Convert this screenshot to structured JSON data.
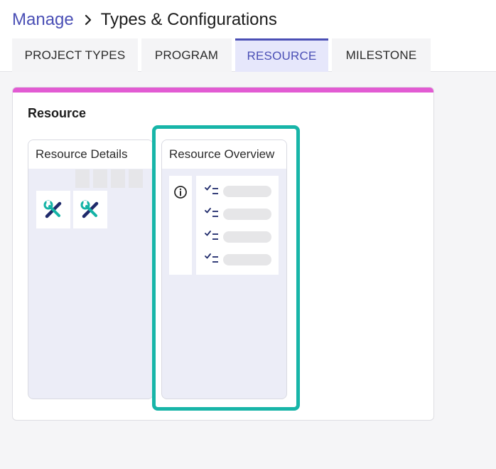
{
  "breadcrumb": {
    "parent": "Manage",
    "current": "Types & Configurations"
  },
  "tabs": [
    {
      "label": "PROJECT TYPES",
      "active": false
    },
    {
      "label": "PROGRAM",
      "active": false
    },
    {
      "label": "RESOURCE",
      "active": true
    },
    {
      "label": "MILESTONE",
      "active": false
    }
  ],
  "panel": {
    "title": "Resource",
    "accent_color": "#e25bd3"
  },
  "cards": {
    "details": {
      "title": "Resource Details",
      "icons": [
        "tools-icon",
        "tools-icon"
      ]
    },
    "overview": {
      "title": "Resource Overview",
      "icons": [
        "info-icon",
        "checklist-icon",
        "checklist-icon",
        "checklist-icon",
        "checklist-icon"
      ],
      "selected": true
    }
  },
  "colors": {
    "brand": "#4a4fb5",
    "highlight": "#17b5a8",
    "tool_primary": "#1f2a6b",
    "tool_secondary": "#15b3a6"
  }
}
